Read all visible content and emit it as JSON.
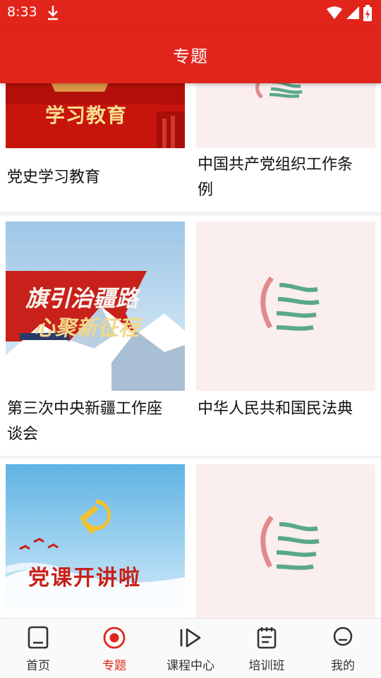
{
  "status_bar": {
    "time": "8:33"
  },
  "header": {
    "title": "专题"
  },
  "cards": [
    {
      "title": "党史学习教育",
      "image_text": "学习教育"
    },
    {
      "title": "中国共产党组织工作条例"
    },
    {
      "title": "第三次中央新疆工作座谈会",
      "image_text_line1": "旗引治疆路",
      "image_text_line2": "心聚新征程"
    },
    {
      "title": "中华人民共和国民法典"
    },
    {
      "title": "",
      "image_text": "党课开讲啦"
    },
    {
      "title": ""
    }
  ],
  "tabs": [
    {
      "label": "首页",
      "icon": "home-icon"
    },
    {
      "label": "专题",
      "icon": "topic-record-icon",
      "active": true
    },
    {
      "label": "课程中心",
      "icon": "play-icon"
    },
    {
      "label": "培训班",
      "icon": "notebook-icon"
    },
    {
      "label": "我的",
      "icon": "profile-icon"
    }
  ],
  "colors": {
    "brand_red": "#e1251b",
    "logo_pink": "#e08a8a",
    "logo_green": "#5aa88a"
  }
}
